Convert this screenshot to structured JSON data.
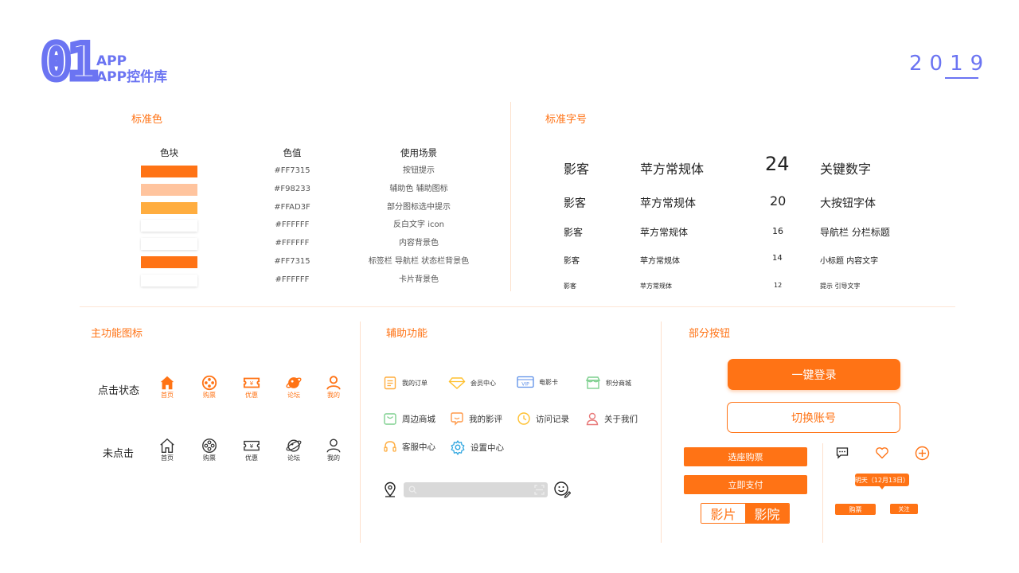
{
  "header": {
    "number": "01",
    "line1": "APP",
    "line2": "APP控件库",
    "year": "2019"
  },
  "colors": {
    "accent": "#FF7315",
    "brand_blue": "#6B74F2"
  },
  "standard_colors": {
    "title": "标准色",
    "headers": {
      "swatch": "色块",
      "value": "色值",
      "usage": "使用场景"
    },
    "rows": [
      {
        "swatch": "#FF7315",
        "value": "#FF7315",
        "usage": "按钮提示"
      },
      {
        "swatch": "#FFC49E",
        "value": "#F98233",
        "usage": "辅助色 辅助图标"
      },
      {
        "swatch": "#FFAD3F",
        "value": "#FFAD3F",
        "usage": "部分图标选中提示"
      },
      {
        "swatch": "#FFFFFF",
        "value": "#FFFFFF",
        "usage": "反白文字 icon"
      },
      {
        "swatch": "#FFFFFF",
        "value": "#FFFFFF",
        "usage": "内容背景色"
      },
      {
        "swatch": "#FF7315",
        "value": "#FF7315",
        "usage": "标签栏 导航栏 状态栏背景色"
      },
      {
        "swatch": "#FFFFFF",
        "value": "#FFFFFF",
        "usage": "卡片背景色"
      }
    ]
  },
  "standard_fonts": {
    "title": "标准字号",
    "rows": [
      {
        "sample": "影客",
        "font": "苹方常规体",
        "size": "24",
        "usage": "关键数字"
      },
      {
        "sample": "影客",
        "font": "苹方常规体",
        "size": "20",
        "usage": "大按钮字体"
      },
      {
        "sample": "影客",
        "font": "苹方常规体",
        "size": "16",
        "usage": "导航栏 分栏标题"
      },
      {
        "sample": "影客",
        "font": "苹方常规体",
        "size": "14",
        "usage": "小标题 内容文字"
      },
      {
        "sample": "影客",
        "font": "苹方常规体",
        "size": "12",
        "usage": "提示 引导文字"
      }
    ]
  },
  "main_icons": {
    "title": "主功能图标",
    "active_label": "点击状态",
    "inactive_label": "未点击",
    "items": [
      {
        "icon": "home-icon",
        "label": "首页"
      },
      {
        "icon": "film-reel-icon",
        "label": "购票"
      },
      {
        "icon": "coupon-icon",
        "label": "优惠"
      },
      {
        "icon": "planet-icon",
        "label": "论坛"
      },
      {
        "icon": "user-icon",
        "label": "我的"
      }
    ]
  },
  "aux": {
    "title": "辅助功能",
    "row1": [
      {
        "icon": "order-icon",
        "label": "我的订单"
      },
      {
        "icon": "diamond-icon",
        "label": "会员中心"
      },
      {
        "icon": "vip-card-icon",
        "label": "电影卡"
      },
      {
        "icon": "shop-icon",
        "label": "积分商城"
      }
    ],
    "row2": [
      {
        "icon": "bag-icon",
        "label": "周边商城"
      },
      {
        "icon": "comment-icon",
        "label": "我的影评"
      },
      {
        "icon": "clock-icon",
        "label": "访问记录"
      },
      {
        "icon": "person-icon",
        "label": "关于我们"
      }
    ],
    "row3": [
      {
        "icon": "headset-icon",
        "label": "客服中心"
      },
      {
        "icon": "gear-icon",
        "label": "设置中心"
      }
    ],
    "vip_text": "VIP"
  },
  "buttons": {
    "title": "部分按钮",
    "login": "一键登录",
    "switch_account": "切换账号",
    "select_seat": "选座购票",
    "pay_now": "立即支付",
    "seg_film": "影片",
    "seg_cinema": "影院",
    "tooltip": "明天（12月13日）",
    "buy": "购票",
    "follow": "关注"
  }
}
